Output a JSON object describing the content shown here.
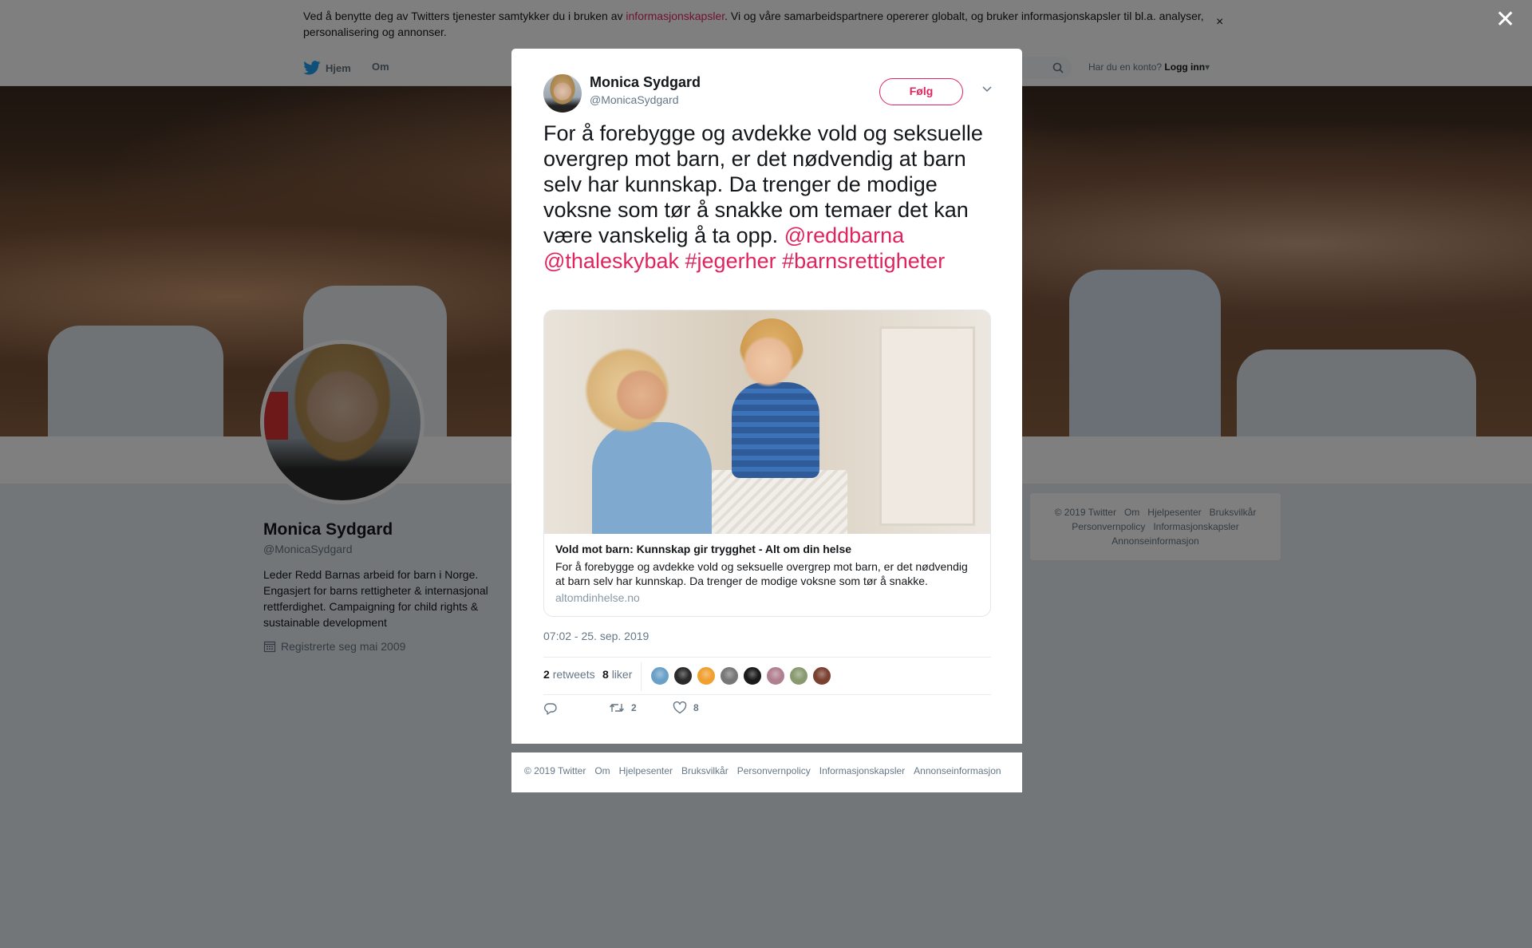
{
  "cookie": {
    "text_before": "Ved å benytte deg av Twitters tjenester samtykker du i bruken av ",
    "link": "informasjonskapsler",
    "text_after": ". Vi og våre samarbeidspartnere opererer globalt, og bruker informasjonskapsler til bl.a. analyser, personalisering og annonser.",
    "close": "×"
  },
  "nav": {
    "home": "Hjem",
    "about": "Om",
    "account_prompt": "Har du en konto?",
    "login": "Logg inn"
  },
  "profile": {
    "name": "Monica Sydgard",
    "handle": "@MonicaSydgard",
    "bio": "Leder Redd Barnas arbeid for barn i Norge. Engasjert for barns rettigheter & internasjonal rettferdighet. Campaigning for child rights & sustainable development",
    "joined": "Registrerte seg mai 2009"
  },
  "side_footer": [
    "© 2019 Twitter",
    "Om",
    "Hjelpesenter",
    "Bruksvilkår",
    "Personvernpolicy",
    "Informasjonskapsler",
    "Annonseinformasjon"
  ],
  "overlay_close": "✕",
  "tweet": {
    "name": "Monica Sydgard",
    "handle": "@MonicaSydgard",
    "follow": "Følg",
    "text": "For å forebygge og avdekke vold og seksuelle overgrep mot barn, er det nødvendig at barn selv har kunnskap. Da trenger de modige voksne som tør å snakke om temaer det kan være vanskelig å ta opp.",
    "tags": [
      "@reddbarna",
      "@thaleskybak",
      "#jegerher",
      "#barnsrettigheter"
    ],
    "card": {
      "title": "Vold mot barn: Kunnskap gir trygghet - Alt om din helse",
      "description": "For å forebygge og avdekke vold og seksuelle overgrep mot barn, er det nødvendig at barn selv har kunnskap. Da trenger de modige voksne som tør å snakke.",
      "domain": "altomdinhelse.no"
    },
    "timestamp": "07:02 - 25. sep. 2019",
    "retweets_count": "2",
    "retweets_label": "retweets",
    "likes_count": "8",
    "likes_label": "liker",
    "action_retweets": "2",
    "action_likes": "8"
  },
  "modal_footer": [
    "© 2019 Twitter",
    "Om",
    "Hjelpesenter",
    "Bruksvilkår",
    "Personvernpolicy",
    "Informasjonskapsler",
    "Annonseinformasjon"
  ],
  "colors": {
    "accent": "#e0245e",
    "text": "#14171a",
    "muted": "#657786",
    "twitter_blue": "#1da1f2"
  },
  "likers": [
    "#6aa0c8",
    "#2a2a2a",
    "#f0a030",
    "#777777",
    "#1a1a1a",
    "#b08090",
    "#8a9a70",
    "#7a4030"
  ]
}
